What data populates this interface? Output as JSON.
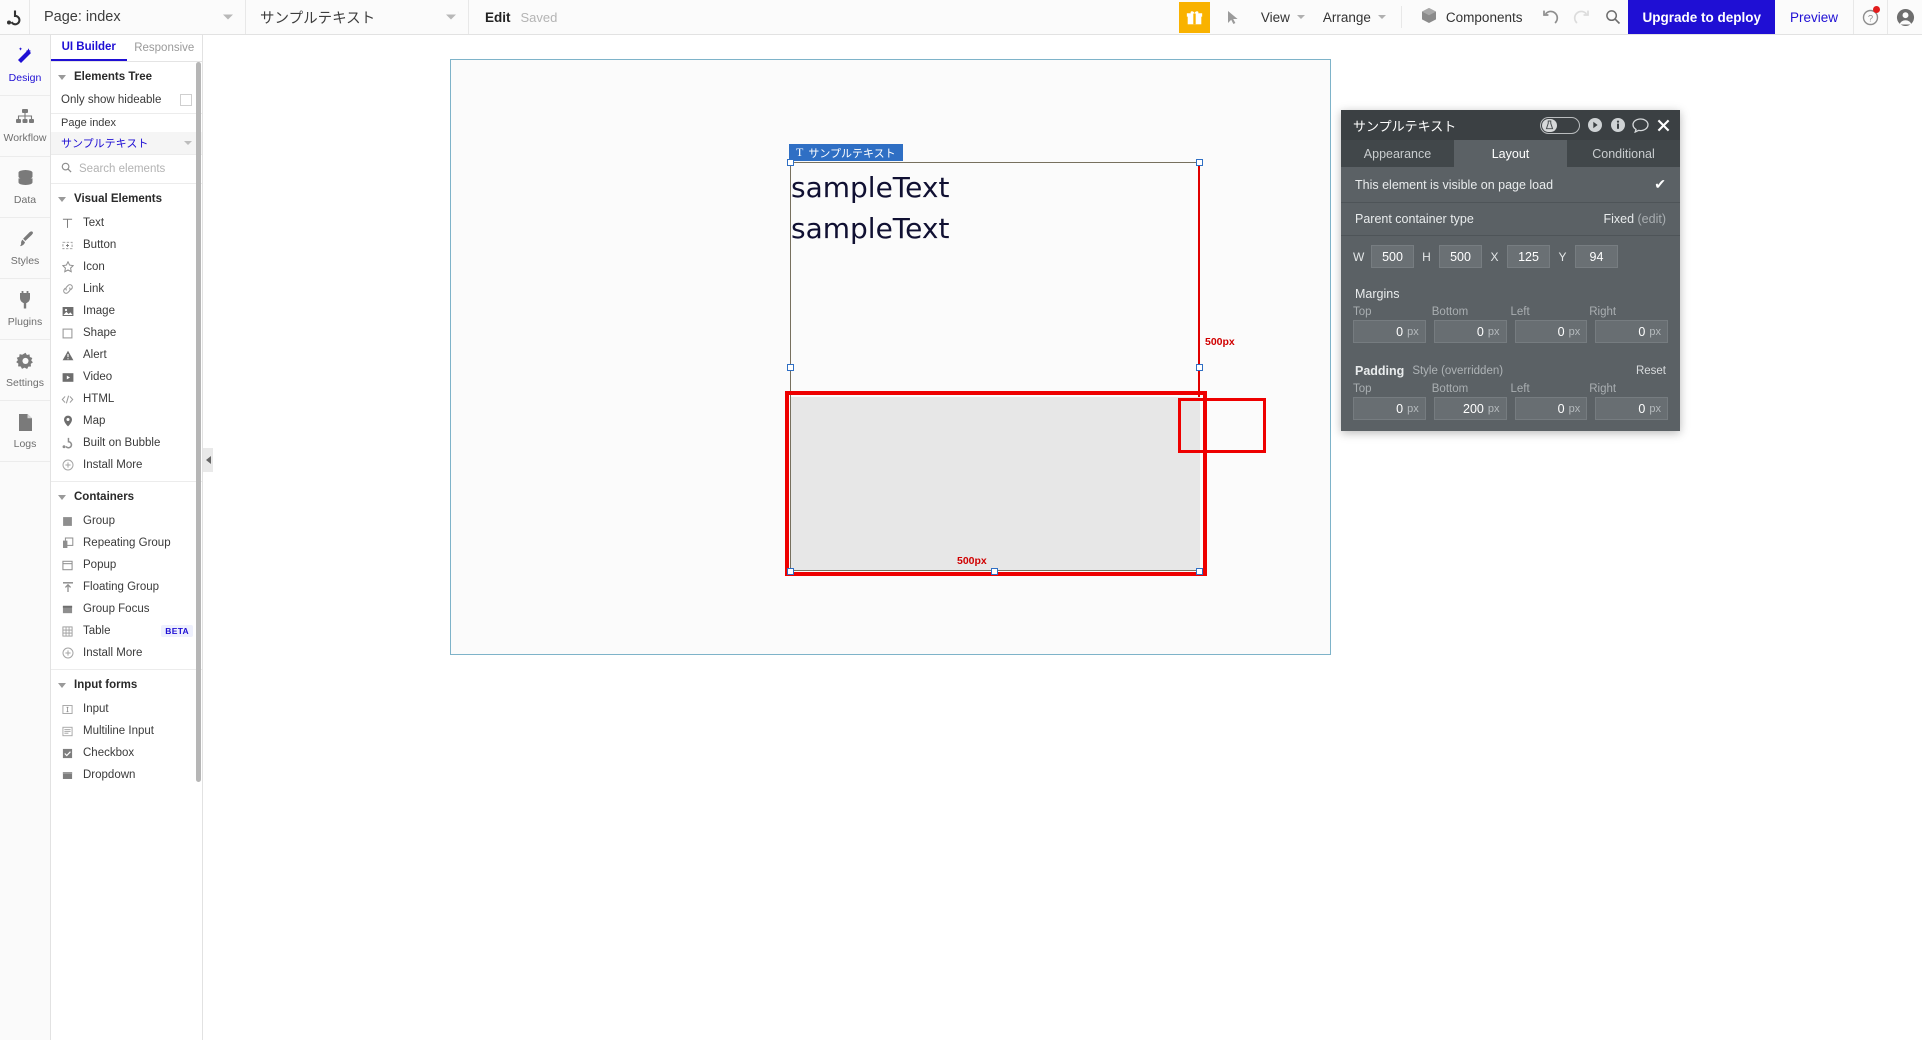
{
  "topbar": {
    "logo_icon": "bubble-logo-icon",
    "page_selector": "Page: index",
    "element_selector": "サンプルテキスト",
    "edit_label": "Edit",
    "save_status": "Saved",
    "gift_icon": "gift-icon",
    "cursor_icon": "cursor-arrow-icon",
    "view_menu": "View",
    "arrange_menu": "Arrange",
    "components_label": "Components",
    "components_icon": "cube-icon",
    "undo_icon": "undo-icon",
    "redo_icon": "redo-icon",
    "search_icon": "search-icon",
    "upgrade_label": "Upgrade to deploy",
    "preview_label": "Preview",
    "help_icon": "help-question-icon",
    "account_icon": "user-avatar-icon"
  },
  "rail": {
    "items": [
      {
        "label": "Design",
        "icon": "design-wand-icon",
        "active": true
      },
      {
        "label": "Workflow",
        "icon": "workflow-tree-icon",
        "active": false
      },
      {
        "label": "Data",
        "icon": "database-icon",
        "active": false
      },
      {
        "label": "Styles",
        "icon": "paintbrush-icon",
        "active": false
      },
      {
        "label": "Plugins",
        "icon": "plug-icon",
        "active": false
      },
      {
        "label": "Settings",
        "icon": "gear-icon",
        "active": false
      },
      {
        "label": "Logs",
        "icon": "document-icon",
        "active": false
      }
    ]
  },
  "panel": {
    "tabs": [
      {
        "label": "UI Builder",
        "active": true
      },
      {
        "label": "Responsive",
        "active": false
      }
    ],
    "elements_tree_label": "Elements Tree",
    "only_show_hideable": "Only show hideable",
    "tree": [
      {
        "label": "Page index",
        "selected": false
      },
      {
        "label": "サンプルテキスト",
        "selected": true
      }
    ],
    "search_placeholder": "Search elements",
    "groups": [
      {
        "title": "Visual Elements",
        "items": [
          {
            "label": "Text",
            "icon": "text-t-icon"
          },
          {
            "label": "Button",
            "icon": "button-icon"
          },
          {
            "label": "Icon",
            "icon": "star-icon"
          },
          {
            "label": "Link",
            "icon": "link-chain-icon"
          },
          {
            "label": "Image",
            "icon": "image-icon"
          },
          {
            "label": "Shape",
            "icon": "square-shape-icon"
          },
          {
            "label": "Alert",
            "icon": "alert-triangle-icon"
          },
          {
            "label": "Video",
            "icon": "video-play-icon"
          },
          {
            "label": "HTML",
            "icon": "code-brackets-icon"
          },
          {
            "label": "Map",
            "icon": "map-pin-icon"
          },
          {
            "label": "Built on Bubble",
            "icon": "bubble-logo-icon"
          },
          {
            "label": "Install More",
            "icon": "plus-circle-icon"
          }
        ]
      },
      {
        "title": "Containers",
        "items": [
          {
            "label": "Group",
            "icon": "group-square-icon"
          },
          {
            "label": "Repeating Group",
            "icon": "repeating-group-icon"
          },
          {
            "label": "Popup",
            "icon": "popup-window-icon"
          },
          {
            "label": "Floating Group",
            "icon": "floating-group-icon"
          },
          {
            "label": "Group Focus",
            "icon": "group-focus-icon"
          },
          {
            "label": "Table",
            "icon": "table-grid-icon",
            "badge": "BETA"
          },
          {
            "label": "Install More",
            "icon": "plus-circle-icon"
          }
        ]
      },
      {
        "title": "Input forms",
        "items": [
          {
            "label": "Input",
            "icon": "input-field-icon"
          },
          {
            "label": "Multiline Input",
            "icon": "multiline-input-icon"
          },
          {
            "label": "Checkbox",
            "icon": "checkbox-icon"
          },
          {
            "label": "Dropdown",
            "icon": "dropdown-icon"
          }
        ]
      }
    ]
  },
  "canvas": {
    "element_label": "サンプルテキスト",
    "element_label_icon": "text-t-icon",
    "sample_line_1": "sampleText",
    "sample_line_2": "sampleText",
    "dim_right": "500px",
    "dim_bottom": "500px"
  },
  "props": {
    "title": "サンプルテキスト",
    "header_icons": [
      "privacy-toggle-icon",
      "play-circle-icon",
      "info-circle-icon",
      "comment-icon",
      "close-icon"
    ],
    "tabs": [
      {
        "label": "Appearance",
        "active": false
      },
      {
        "label": "Layout",
        "active": true
      },
      {
        "label": "Conditional",
        "active": false
      }
    ],
    "visible_on_page_load": "This element is visible on page load",
    "visible_checked": "✔",
    "parent_container_label": "Parent container type",
    "parent_container_value": "Fixed",
    "parent_container_edit": "(edit)",
    "size_fields": [
      {
        "label": "W",
        "value": "500"
      },
      {
        "label": "H",
        "value": "500"
      },
      {
        "label": "X",
        "value": "125"
      },
      {
        "label": "Y",
        "value": "94"
      }
    ],
    "margins": {
      "title": "Margins",
      "labels": [
        "Top",
        "Bottom",
        "Left",
        "Right"
      ],
      "values": [
        "0",
        "0",
        "0",
        "0"
      ],
      "unit": "px"
    },
    "padding": {
      "title": "Padding",
      "style_note": "Style (overridden)",
      "reset": "Reset",
      "labels": [
        "Top",
        "Bottom",
        "Left",
        "Right"
      ],
      "values": [
        "0",
        "200",
        "0",
        "0"
      ],
      "unit": "px",
      "highlighted_index": 1
    }
  },
  "colors": {
    "accent_blue": "#1f0fd4",
    "gift_orange": "#f9b200",
    "annotation_red": "#ee0000",
    "panel_dark": "#5b6165",
    "panel_header": "#3b4043",
    "selection_blue": "#2f6fc4"
  }
}
